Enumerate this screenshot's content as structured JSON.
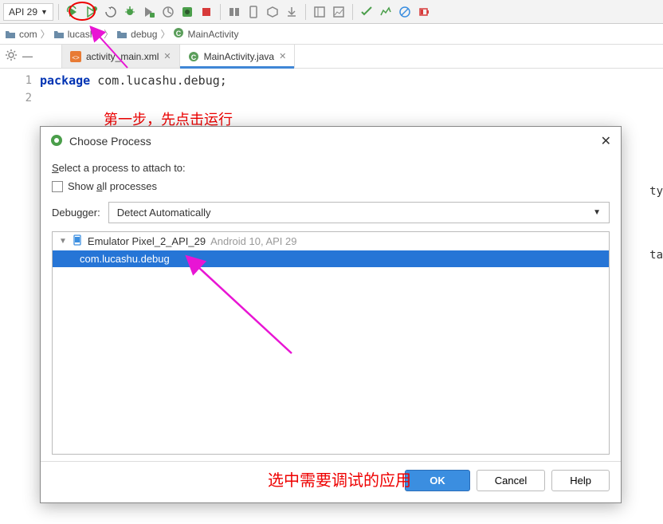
{
  "toolbar": {
    "device": "API 29"
  },
  "breadcrumb": {
    "items": [
      "com",
      "lucashu",
      "debug",
      "MainActivity"
    ]
  },
  "tabs": {
    "file1": "activity_main.xml",
    "file2": "MainActivity.java"
  },
  "editor": {
    "line1_num": "1",
    "line2_num": "2",
    "code1_kw": "package",
    "code1_rest": " com.lucashu.debug;"
  },
  "annotation1": "第一步，先点击运行",
  "annotation2": "选中需要调试的应用",
  "right_text1": "ty",
  "right_text2": "ta",
  "dialog": {
    "title": "Choose Process",
    "select_label_pre": "S",
    "select_label_rest": "elect a process to attach to:",
    "show_all_pre": "Show ",
    "show_all_u": "a",
    "show_all_rest": "ll processes",
    "debugger_label": "Debugger:",
    "debugger_value": "Detect Automatically",
    "tree_device": "Emulator Pixel_2_API_29",
    "tree_device_meta": "Android 10, API 29",
    "tree_process": "com.lucashu.debug",
    "ok": "OK",
    "cancel": "Cancel",
    "help": "Help"
  }
}
